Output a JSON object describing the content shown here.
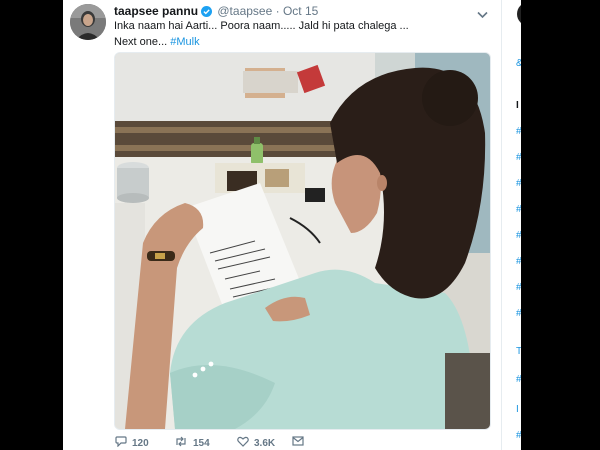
{
  "tweet": {
    "display_name": "taapsee pannu",
    "handle": "@taapsee",
    "separator": "·",
    "time": "Oct 15",
    "line1": "Inka naam hai Aarti... Poora naam..... Jald hi pata chalega ...",
    "line2_prefix": "Next one...",
    "hashtag": "#Mulk",
    "replies": "120",
    "retweets": "154",
    "likes": "3.6K"
  },
  "icons": {
    "verified": "verified-badge-icon",
    "caret": "chevron-down-icon",
    "reply": "reply-icon",
    "retweet": "retweet-icon",
    "like": "heart-icon",
    "message": "envelope-icon"
  },
  "colors": {
    "link": "#1b95e0",
    "text": "#14171a",
    "muted": "#657786"
  }
}
